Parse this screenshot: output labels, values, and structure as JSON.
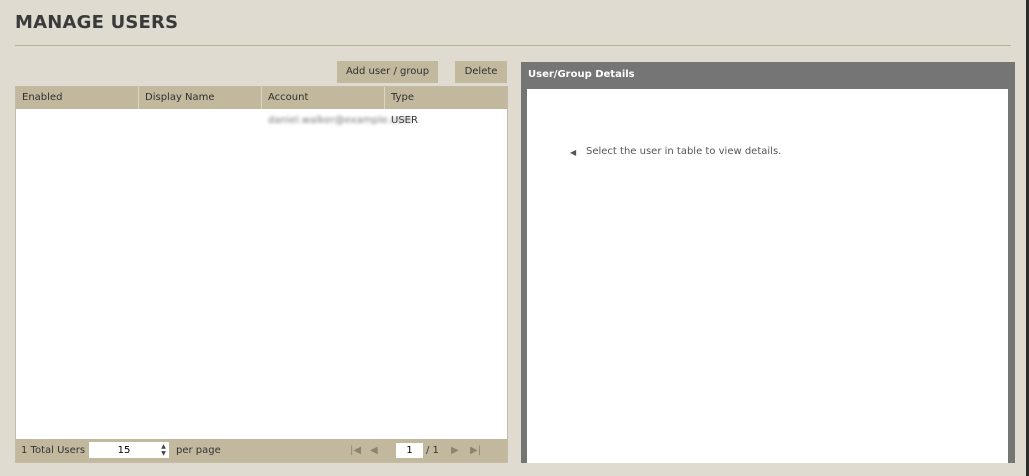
{
  "page": {
    "title": "MANAGE USERS"
  },
  "toolbar": {
    "add_label": "Add user / group",
    "delete_label": "Delete"
  },
  "table": {
    "columns": [
      "Enabled",
      "Display Name",
      "Account",
      "Type"
    ],
    "rows": [
      {
        "enabled": "",
        "display_name": "",
        "account": "daniel.walker@example.com",
        "type": "USER"
      }
    ]
  },
  "footer": {
    "total_label": "1 Total Users",
    "per_page_value": "15",
    "per_page_label": "per page",
    "page_value": "1",
    "page_total": "/ 1"
  },
  "details": {
    "title": "User/Group Details",
    "hint": "Select the user in table to view details."
  },
  "icons": {
    "first": "first-page-icon",
    "prev": "prev-page-icon",
    "next": "next-page-icon",
    "last": "last-page-icon",
    "hint": "left-arrow-icon",
    "spin": "spinner-icon"
  },
  "colors": {
    "background": "#e0dbd0",
    "header": "#c2b89e",
    "panel": "#757575"
  }
}
